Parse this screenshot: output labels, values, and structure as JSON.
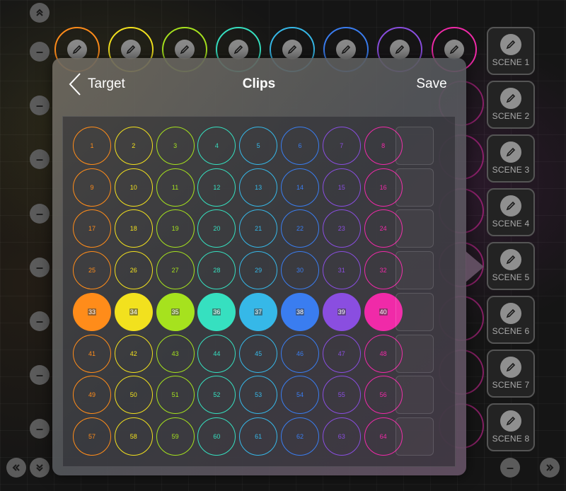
{
  "dialog": {
    "back_label": "Target",
    "title": "Clips",
    "save_label": "Save"
  },
  "scenes": [
    {
      "label": "SCENE 1"
    },
    {
      "label": "SCENE 2"
    },
    {
      "label": "SCENE 3"
    },
    {
      "label": "SCENE 4"
    },
    {
      "label": "SCENE 5"
    },
    {
      "label": "SCENE 6"
    },
    {
      "label": "SCENE 7"
    },
    {
      "label": "SCENE 8"
    }
  ],
  "column_colors": [
    "#ff8c1a",
    "#f2e11e",
    "#a6e21e",
    "#36e0c0",
    "#36b8e8",
    "#3a7df0",
    "#8a4ee0",
    "#f02aa8"
  ],
  "clip_rows": [
    [
      "1",
      "2",
      "3",
      "4",
      "5",
      "6",
      "7",
      "8"
    ],
    [
      "9",
      "10",
      "11",
      "12",
      "13",
      "14",
      "15",
      "16"
    ],
    [
      "17",
      "18",
      "19",
      "20",
      "21",
      "22",
      "23",
      "24"
    ],
    [
      "25",
      "26",
      "27",
      "28",
      "29",
      "30",
      "31",
      "32"
    ],
    [
      "33",
      "34",
      "35",
      "36",
      "37",
      "38",
      "39",
      "40"
    ],
    [
      "41",
      "42",
      "43",
      "44",
      "45",
      "46",
      "47",
      "48"
    ],
    [
      "49",
      "50",
      "51",
      "52",
      "53",
      "54",
      "55",
      "56"
    ],
    [
      "57",
      "58",
      "59",
      "60",
      "61",
      "62",
      "63",
      "64"
    ]
  ],
  "active_row_index": 4,
  "icons": {
    "collapse_up": "double-chevron-up-icon",
    "collapse_down": "double-chevron-down-icon",
    "scroll_left": "double-chevron-left-icon",
    "scroll_right": "double-chevron-right-icon",
    "minus": "minus-icon",
    "edit": "pencil-icon",
    "back": "chevron-left-icon"
  }
}
